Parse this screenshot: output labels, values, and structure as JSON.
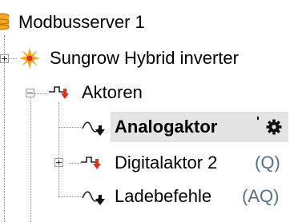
{
  "tree": {
    "items": [
      {
        "label": "Modbusserver 1",
        "suffix": "",
        "icon": "modbus-server-icon"
      },
      {
        "label": "Sungrow Hybrid inverter",
        "suffix": "",
        "icon": "sungrow-logo-icon"
      },
      {
        "label": "Aktoren",
        "suffix": "",
        "icon": "actor-folder-icon"
      },
      {
        "label": "Analogaktor",
        "suffix": "",
        "icon": "analog-actor-icon",
        "selected": true,
        "extra_icon": "gear-icon"
      },
      {
        "label": "Digitalaktor 2",
        "suffix": "(Q)",
        "icon": "digital-actor-icon"
      },
      {
        "label": "Ladebefehle",
        "suffix": "(AQ)",
        "icon": "analog-actor-icon"
      }
    ]
  },
  "colors": {
    "selection_bg": "#e4e4e4",
    "suffix_text": "#5a6f86",
    "dotted_line": "#8c8c8c",
    "accent_red": "#e0301e",
    "accent_orange": "#f5a623"
  }
}
